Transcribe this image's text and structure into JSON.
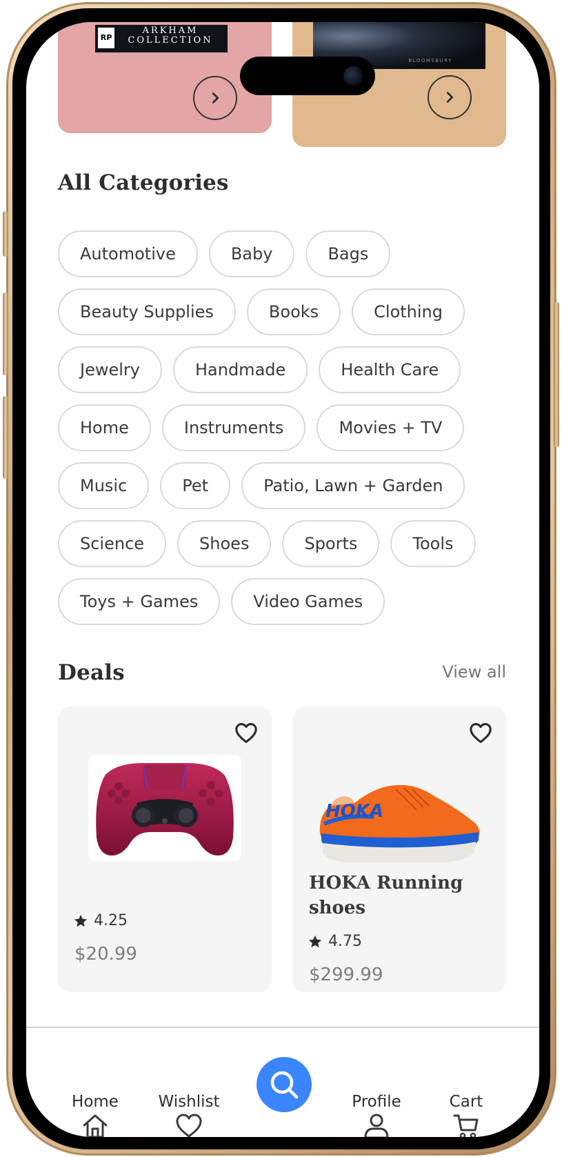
{
  "promos": {
    "left_brand_line1": "ARKHAM",
    "left_brand_line2": "COLLECTION",
    "left_rating_badge": "RP",
    "right_publisher": "BLOOMSBURY"
  },
  "categories": {
    "title": "All Categories",
    "rows": [
      [
        "Automotive",
        "Baby",
        "Bags"
      ],
      [
        "Beauty Supplies",
        "Books",
        "Clothing"
      ],
      [
        "Jewelry",
        "Handmade",
        "Health Care"
      ],
      [
        "Home",
        "Instruments",
        "Movies + TV"
      ],
      [
        "Music",
        "Pet",
        "Patio, Lawn + Garden"
      ],
      [
        "Science",
        "Shoes",
        "Sports",
        "Tools"
      ],
      [
        "Toys + Games",
        "Video Games"
      ]
    ]
  },
  "deals": {
    "title": "Deals",
    "view_all": "View all",
    "items": [
      {
        "name": "",
        "rating": "4.25",
        "price": "$20.99",
        "image": "game-controller"
      },
      {
        "name": "HOKA Running shoes",
        "rating": "4.75",
        "price": "$299.99",
        "image": "running-shoe"
      }
    ]
  },
  "nav": {
    "items": [
      {
        "label": "Home",
        "icon": "home-icon"
      },
      {
        "label": "Wishlist",
        "icon": "heart-icon"
      },
      {
        "label": "",
        "icon": "search-icon"
      },
      {
        "label": "Profile",
        "icon": "user-icon"
      },
      {
        "label": "Cart",
        "icon": "cart-icon"
      }
    ]
  },
  "colors": {
    "accent": "#3b86ff",
    "promo_left": "#e3a5a5",
    "promo_right": "#e1b98f",
    "card_bg": "#f5f5f5",
    "chip_border": "#d9d9d9",
    "frame_gold": "#d4b38a"
  }
}
